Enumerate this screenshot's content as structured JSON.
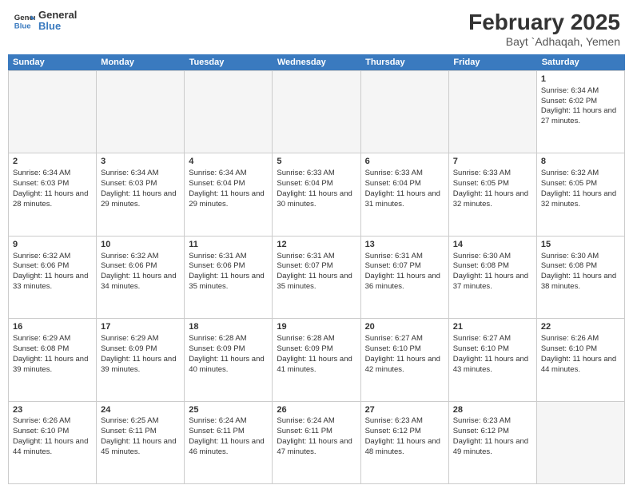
{
  "header": {
    "logo_general": "General",
    "logo_blue": "Blue",
    "month_year": "February 2025",
    "location": "Bayt `Adhaqah, Yemen"
  },
  "days_of_week": [
    "Sunday",
    "Monday",
    "Tuesday",
    "Wednesday",
    "Thursday",
    "Friday",
    "Saturday"
  ],
  "weeks": [
    [
      {
        "day": "",
        "empty": true
      },
      {
        "day": "",
        "empty": true
      },
      {
        "day": "",
        "empty": true
      },
      {
        "day": "",
        "empty": true
      },
      {
        "day": "",
        "empty": true
      },
      {
        "day": "",
        "empty": true
      },
      {
        "day": "1",
        "sunrise": "Sunrise: 6:34 AM",
        "sunset": "Sunset: 6:02 PM",
        "daylight": "Daylight: 11 hours and 27 minutes."
      }
    ],
    [
      {
        "day": "2",
        "sunrise": "Sunrise: 6:34 AM",
        "sunset": "Sunset: 6:03 PM",
        "daylight": "Daylight: 11 hours and 28 minutes."
      },
      {
        "day": "3",
        "sunrise": "Sunrise: 6:34 AM",
        "sunset": "Sunset: 6:03 PM",
        "daylight": "Daylight: 11 hours and 29 minutes."
      },
      {
        "day": "4",
        "sunrise": "Sunrise: 6:34 AM",
        "sunset": "Sunset: 6:04 PM",
        "daylight": "Daylight: 11 hours and 29 minutes."
      },
      {
        "day": "5",
        "sunrise": "Sunrise: 6:33 AM",
        "sunset": "Sunset: 6:04 PM",
        "daylight": "Daylight: 11 hours and 30 minutes."
      },
      {
        "day": "6",
        "sunrise": "Sunrise: 6:33 AM",
        "sunset": "Sunset: 6:04 PM",
        "daylight": "Daylight: 11 hours and 31 minutes."
      },
      {
        "day": "7",
        "sunrise": "Sunrise: 6:33 AM",
        "sunset": "Sunset: 6:05 PM",
        "daylight": "Daylight: 11 hours and 32 minutes."
      },
      {
        "day": "8",
        "sunrise": "Sunrise: 6:32 AM",
        "sunset": "Sunset: 6:05 PM",
        "daylight": "Daylight: 11 hours and 32 minutes."
      }
    ],
    [
      {
        "day": "9",
        "sunrise": "Sunrise: 6:32 AM",
        "sunset": "Sunset: 6:06 PM",
        "daylight": "Daylight: 11 hours and 33 minutes."
      },
      {
        "day": "10",
        "sunrise": "Sunrise: 6:32 AM",
        "sunset": "Sunset: 6:06 PM",
        "daylight": "Daylight: 11 hours and 34 minutes."
      },
      {
        "day": "11",
        "sunrise": "Sunrise: 6:31 AM",
        "sunset": "Sunset: 6:06 PM",
        "daylight": "Daylight: 11 hours and 35 minutes."
      },
      {
        "day": "12",
        "sunrise": "Sunrise: 6:31 AM",
        "sunset": "Sunset: 6:07 PM",
        "daylight": "Daylight: 11 hours and 35 minutes."
      },
      {
        "day": "13",
        "sunrise": "Sunrise: 6:31 AM",
        "sunset": "Sunset: 6:07 PM",
        "daylight": "Daylight: 11 hours and 36 minutes."
      },
      {
        "day": "14",
        "sunrise": "Sunrise: 6:30 AM",
        "sunset": "Sunset: 6:08 PM",
        "daylight": "Daylight: 11 hours and 37 minutes."
      },
      {
        "day": "15",
        "sunrise": "Sunrise: 6:30 AM",
        "sunset": "Sunset: 6:08 PM",
        "daylight": "Daylight: 11 hours and 38 minutes."
      }
    ],
    [
      {
        "day": "16",
        "sunrise": "Sunrise: 6:29 AM",
        "sunset": "Sunset: 6:08 PM",
        "daylight": "Daylight: 11 hours and 39 minutes."
      },
      {
        "day": "17",
        "sunrise": "Sunrise: 6:29 AM",
        "sunset": "Sunset: 6:09 PM",
        "daylight": "Daylight: 11 hours and 39 minutes."
      },
      {
        "day": "18",
        "sunrise": "Sunrise: 6:28 AM",
        "sunset": "Sunset: 6:09 PM",
        "daylight": "Daylight: 11 hours and 40 minutes."
      },
      {
        "day": "19",
        "sunrise": "Sunrise: 6:28 AM",
        "sunset": "Sunset: 6:09 PM",
        "daylight": "Daylight: 11 hours and 41 minutes."
      },
      {
        "day": "20",
        "sunrise": "Sunrise: 6:27 AM",
        "sunset": "Sunset: 6:10 PM",
        "daylight": "Daylight: 11 hours and 42 minutes."
      },
      {
        "day": "21",
        "sunrise": "Sunrise: 6:27 AM",
        "sunset": "Sunset: 6:10 PM",
        "daylight": "Daylight: 11 hours and 43 minutes."
      },
      {
        "day": "22",
        "sunrise": "Sunrise: 6:26 AM",
        "sunset": "Sunset: 6:10 PM",
        "daylight": "Daylight: 11 hours and 44 minutes."
      }
    ],
    [
      {
        "day": "23",
        "sunrise": "Sunrise: 6:26 AM",
        "sunset": "Sunset: 6:10 PM",
        "daylight": "Daylight: 11 hours and 44 minutes."
      },
      {
        "day": "24",
        "sunrise": "Sunrise: 6:25 AM",
        "sunset": "Sunset: 6:11 PM",
        "daylight": "Daylight: 11 hours and 45 minutes."
      },
      {
        "day": "25",
        "sunrise": "Sunrise: 6:24 AM",
        "sunset": "Sunset: 6:11 PM",
        "daylight": "Daylight: 11 hours and 46 minutes."
      },
      {
        "day": "26",
        "sunrise": "Sunrise: 6:24 AM",
        "sunset": "Sunset: 6:11 PM",
        "daylight": "Daylight: 11 hours and 47 minutes."
      },
      {
        "day": "27",
        "sunrise": "Sunrise: 6:23 AM",
        "sunset": "Sunset: 6:12 PM",
        "daylight": "Daylight: 11 hours and 48 minutes."
      },
      {
        "day": "28",
        "sunrise": "Sunrise: 6:23 AM",
        "sunset": "Sunset: 6:12 PM",
        "daylight": "Daylight: 11 hours and 49 minutes."
      },
      {
        "day": "",
        "empty": true
      }
    ]
  ]
}
